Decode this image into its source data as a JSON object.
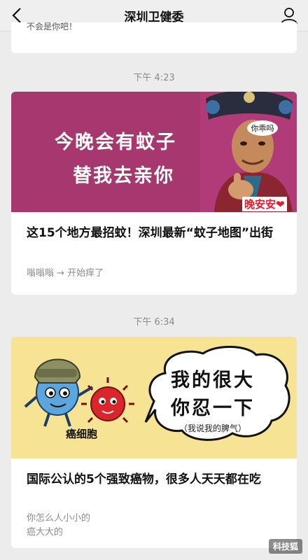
{
  "header": {
    "title": "深圳卫健委"
  },
  "stub": {
    "text": "不会是你吧！"
  },
  "messages": [
    {
      "time": "下午 4:23",
      "banner_lines": [
        "今晚会有蚊子",
        "替我去亲你"
      ],
      "face_bubble": "你乖吗",
      "goodnight": "晚安安❤",
      "headline": "这15个地方最招蚊！深圳最新“蚊子地图”出街",
      "summary": "嗡嗡嗡 → 开始痒了"
    },
    {
      "time": "下午 6:34",
      "bubble_lines": [
        "我的很大",
        "你忍一下"
      ],
      "bubble_note": "（我说我的脾气）",
      "character_label": "癌细胞",
      "headline": "国际公认的5个强致癌物，很多人天天都在吃",
      "summary_lines": [
        "你怎么人小小的",
        "癌大大的"
      ]
    }
  ],
  "watermark": "科技狐"
}
